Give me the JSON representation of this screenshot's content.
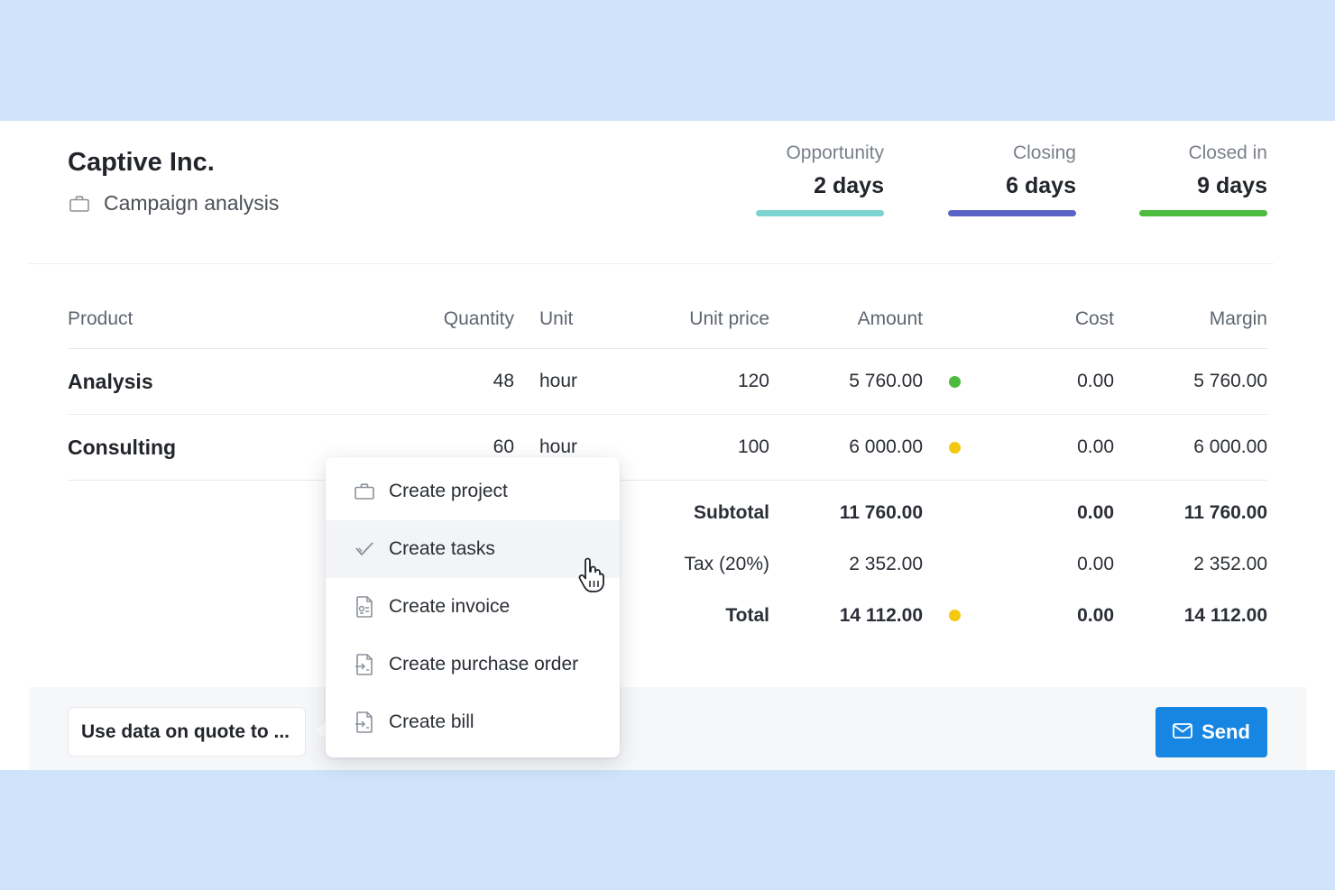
{
  "header": {
    "company": "Captive Inc.",
    "project": "Campaign analysis",
    "project_icon": "briefcase-icon",
    "stages": [
      {
        "label": "Opportunity",
        "value": "2 days",
        "color": "#7dd3cf"
      },
      {
        "label": "Closing",
        "value": "6 days",
        "color": "#5b63c6"
      },
      {
        "label": "Closed in",
        "value": "9 days",
        "color": "#4cbb3e"
      }
    ]
  },
  "table": {
    "columns": [
      "Product",
      "Quantity",
      "Unit",
      "Unit price",
      "Amount",
      "Cost",
      "Margin"
    ],
    "rows": [
      {
        "product": "Analysis",
        "quantity": "48",
        "unit": "hour",
        "unit_price": "120",
        "amount": "5 760.00",
        "status_color": "#4cbb3e",
        "cost": "0.00",
        "margin": "5 760.00"
      },
      {
        "product": "Consulting",
        "quantity": "60",
        "unit": "hour",
        "unit_price": "100",
        "amount": "6 000.00",
        "status_color": "#f2c811",
        "cost": "0.00",
        "margin": "6 000.00"
      }
    ],
    "summary": {
      "subtotal": {
        "label": "Subtotal",
        "amount": "11 760.00",
        "cost": "0.00",
        "margin": "11 760.00"
      },
      "tax": {
        "label": "Tax (20%)",
        "amount": "2 352.00",
        "cost": "0.00",
        "margin": "2 352.00"
      },
      "total": {
        "label": "Total",
        "amount": "14 112.00",
        "status_color": "#f2c811",
        "cost": "0.00",
        "margin": "14 112.00"
      }
    }
  },
  "footer": {
    "use_data_label": "Use data on quote to ...",
    "send_label": "Send",
    "send_icon": "mail-icon",
    "accent": "#1785e2"
  },
  "menu": {
    "items": [
      {
        "label": "Create project",
        "icon": "briefcase-icon"
      },
      {
        "label": "Create tasks",
        "icon": "check-icon",
        "hovered": true
      },
      {
        "label": "Create invoice",
        "icon": "invoice-icon"
      },
      {
        "label": "Create purchase order",
        "icon": "purchase-order-icon"
      },
      {
        "label": "Create bill",
        "icon": "bill-icon"
      }
    ]
  }
}
